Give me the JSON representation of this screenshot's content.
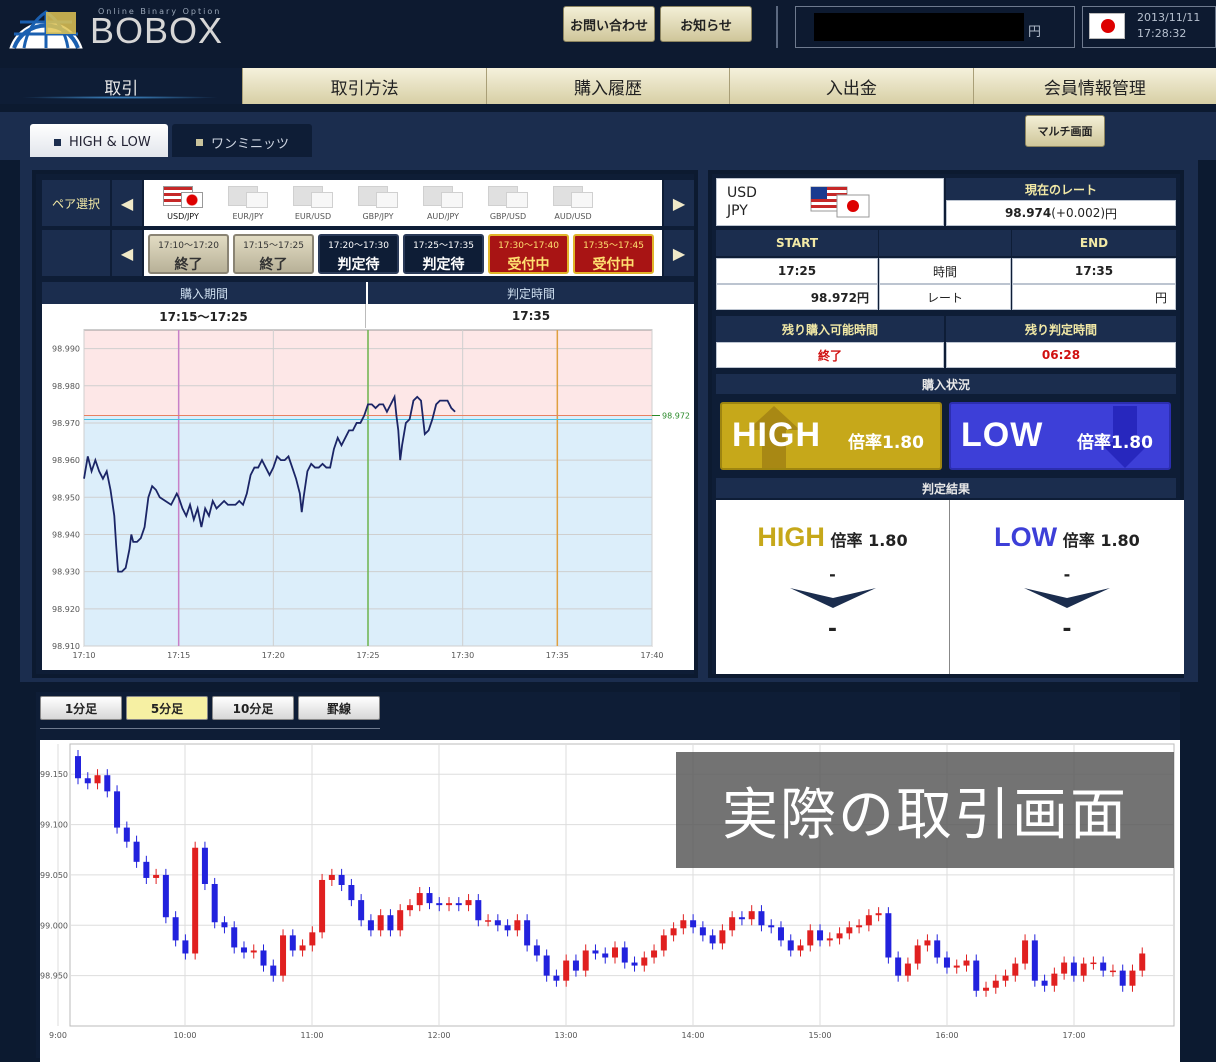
{
  "app": {
    "logo_text": "BOBOX",
    "logo_sub": "Online Binary Option"
  },
  "header": {
    "contact_label": "お問い合わせ",
    "news_label": "お知らせ",
    "balance_unit": "円",
    "date": "2013/11/11",
    "time": "17:28:32"
  },
  "nav": {
    "tabs": [
      {
        "label": "取引"
      },
      {
        "label": "取引方法"
      },
      {
        "label": "購入履歴"
      },
      {
        "label": "入出金"
      },
      {
        "label": "会員情報管理"
      }
    ]
  },
  "modes": {
    "highlow_label": "HIGH & LOW",
    "oneminute_label": "ワンミニッツ",
    "multi_label": "マルチ画面"
  },
  "pairs": {
    "label": "ペア選択",
    "prev": "◀",
    "next": "▶",
    "items": [
      {
        "label": "USD/JPY"
      },
      {
        "label": "EUR/JPY"
      },
      {
        "label": "EUR/USD"
      },
      {
        "label": "GBP/JPY"
      },
      {
        "label": "AUD/JPY"
      },
      {
        "label": "GBP/USD"
      },
      {
        "label": "AUD/USD"
      }
    ]
  },
  "slots": {
    "items": [
      {
        "range": "17:10～17:20",
        "status": "終了",
        "state": "end"
      },
      {
        "range": "17:15～17:25",
        "status": "終了",
        "state": "end"
      },
      {
        "range": "17:20～17:30",
        "status": "判定待",
        "state": "wait"
      },
      {
        "range": "17:25～17:35",
        "status": "判定待",
        "state": "wait"
      },
      {
        "range": "17:30～17:40",
        "status": "受付中",
        "state": "open"
      },
      {
        "range": "17:35～17:45",
        "status": "受付中",
        "state": "open"
      }
    ]
  },
  "trade_info": {
    "period_label": "購入期間",
    "period_value": "17:15～17:25",
    "judge_label": "判定時間",
    "judge_value": "17:35"
  },
  "chart_data": [
    {
      "type": "line",
      "ylim": [
        98.91,
        98.995
      ],
      "y_ticks": [
        "98.990",
        "98.980",
        "98.970",
        "98.960",
        "98.950",
        "98.940",
        "98.930",
        "98.920",
        "98.910"
      ],
      "x_ticks": [
        "17:10",
        "17:15",
        "17:20",
        "17:25",
        "17:30",
        "17:35",
        "17:40"
      ],
      "target_label": "98.972",
      "target": 98.972,
      "markers_time": [
        "17:15",
        "17:25",
        "17:35"
      ],
      "series": [
        {
          "values": [
            [
              0,
              98.955
            ],
            [
              0.2,
              98.961
            ],
            [
              0.4,
              98.957
            ],
            [
              0.6,
              98.96
            ],
            [
              0.8,
              98.957
            ],
            [
              1.0,
              98.955
            ],
            [
              1.2,
              98.957
            ],
            [
              1.4,
              98.952
            ],
            [
              1.6,
              98.945
            ],
            [
              1.7,
              98.937
            ],
            [
              1.8,
              98.93
            ],
            [
              2.0,
              98.93
            ],
            [
              2.2,
              98.931
            ],
            [
              2.4,
              98.936
            ],
            [
              2.5,
              98.94
            ],
            [
              2.6,
              98.938
            ],
            [
              2.8,
              98.938
            ],
            [
              3.0,
              98.939
            ],
            [
              3.2,
              98.942
            ],
            [
              3.4,
              98.95
            ],
            [
              3.6,
              98.953
            ],
            [
              3.8,
              98.952
            ],
            [
              4.0,
              98.95
            ],
            [
              4.3,
              98.949
            ],
            [
              4.6,
              98.948
            ],
            [
              4.9,
              98.951
            ],
            [
              5.0,
              98.95
            ],
            [
              5.2,
              98.947
            ],
            [
              5.4,
              98.945
            ],
            [
              5.6,
              98.948
            ],
            [
              5.8,
              98.944
            ],
            [
              6.0,
              98.947
            ],
            [
              6.2,
              98.942
            ],
            [
              6.4,
              98.947
            ],
            [
              6.6,
              98.945
            ],
            [
              6.8,
              98.949
            ],
            [
              7.0,
              98.947
            ],
            [
              7.2,
              98.948
            ],
            [
              7.4,
              98.949
            ],
            [
              7.6,
              98.948
            ],
            [
              7.8,
              98.948
            ],
            [
              8.0,
              98.948
            ],
            [
              8.2,
              98.949
            ],
            [
              8.4,
              98.948
            ],
            [
              8.6,
              98.951
            ],
            [
              8.8,
              98.956
            ],
            [
              9.0,
              98.958
            ],
            [
              9.2,
              98.958
            ],
            [
              9.4,
              98.96
            ],
            [
              9.6,
              98.958
            ],
            [
              9.8,
              98.956
            ],
            [
              10.0,
              98.958
            ],
            [
              10.2,
              98.961
            ],
            [
              10.4,
              98.96
            ],
            [
              10.6,
              98.96
            ],
            [
              10.8,
              98.961
            ],
            [
              11.0,
              98.958
            ],
            [
              11.2,
              98.955
            ],
            [
              11.4,
              98.951
            ],
            [
              11.5,
              98.946
            ],
            [
              11.6,
              98.95
            ],
            [
              11.8,
              98.957
            ],
            [
              12.0,
              98.959
            ],
            [
              12.2,
              98.958
            ],
            [
              12.4,
              98.958
            ],
            [
              12.6,
              98.959
            ],
            [
              12.8,
              98.958
            ],
            [
              13.0,
              98.958
            ],
            [
              13.2,
              98.963
            ],
            [
              13.4,
              98.966
            ],
            [
              13.6,
              98.964
            ],
            [
              13.8,
              98.966
            ],
            [
              14.0,
              98.968
            ],
            [
              14.2,
              98.968
            ],
            [
              14.4,
              98.97
            ],
            [
              14.6,
              98.97
            ],
            [
              14.8,
              98.972
            ],
            [
              15.0,
              98.975
            ],
            [
              15.2,
              98.975
            ],
            [
              15.4,
              98.974
            ],
            [
              15.6,
              98.975
            ],
            [
              15.8,
              98.975
            ],
            [
              16.0,
              98.973
            ],
            [
              16.2,
              98.975
            ],
            [
              16.4,
              98.977
            ],
            [
              16.5,
              98.972
            ],
            [
              16.6,
              98.968
            ],
            [
              16.7,
              98.96
            ],
            [
              16.8,
              98.964
            ],
            [
              17.0,
              98.97
            ],
            [
              17.2,
              98.971
            ],
            [
              17.4,
              98.976
            ],
            [
              17.6,
              98.977
            ],
            [
              17.8,
              98.976
            ],
            [
              18.0,
              98.967
            ],
            [
              18.2,
              98.968
            ],
            [
              18.4,
              98.971
            ],
            [
              18.6,
              98.975
            ],
            [
              18.8,
              98.976
            ],
            [
              19.0,
              98.976
            ],
            [
              19.2,
              98.976
            ],
            [
              19.4,
              98.974
            ],
            [
              19.6,
              98.973
            ]
          ]
        }
      ]
    },
    {
      "type": "candlestick",
      "ylim": [
        98.9,
        99.18
      ],
      "y_ticks": [
        "99.150",
        "99.100",
        "99.050",
        "99.000",
        "98.950"
      ],
      "x_ticks": [
        "9:00",
        "10:00",
        "11:00",
        "12:00",
        "13:00",
        "14:00",
        "15:00",
        "16:00",
        "17:00"
      ],
      "up_color": "#e02020",
      "down_color": "#2222dd",
      "values": [
        [
          99.168,
          99.146
        ],
        [
          99.146,
          99.141
        ],
        [
          99.141,
          99.149
        ],
        [
          99.149,
          99.133
        ],
        [
          99.133,
          99.097
        ],
        [
          99.097,
          99.083
        ],
        [
          99.083,
          99.063
        ],
        [
          99.063,
          99.047
        ],
        [
          99.047,
          99.05
        ],
        [
          99.05,
          99.008
        ],
        [
          99.008,
          98.985
        ],
        [
          98.985,
          98.972
        ],
        [
          98.972,
          99.077
        ],
        [
          99.077,
          99.041
        ],
        [
          99.041,
          99.003
        ],
        [
          99.003,
          98.998
        ],
        [
          98.998,
          98.978
        ],
        [
          98.978,
          98.973
        ],
        [
          98.973,
          98.975
        ],
        [
          98.975,
          98.96
        ],
        [
          98.96,
          98.95
        ],
        [
          98.95,
          98.99
        ],
        [
          98.99,
          98.975
        ],
        [
          98.975,
          98.98
        ],
        [
          98.98,
          98.993
        ],
        [
          98.993,
          99.045
        ],
        [
          99.045,
          99.05
        ],
        [
          99.05,
          99.04
        ],
        [
          99.04,
          99.025
        ],
        [
          99.025,
          99.005
        ],
        [
          99.005,
          98.995
        ],
        [
          98.995,
          99.01
        ],
        [
          99.01,
          98.995
        ],
        [
          98.995,
          99.015
        ],
        [
          99.015,
          99.02
        ],
        [
          99.02,
          99.032
        ],
        [
          99.032,
          99.022
        ],
        [
          99.022,
          99.02
        ],
        [
          99.02,
          99.022
        ],
        [
          99.022,
          99.02
        ],
        [
          99.02,
          99.025
        ],
        [
          99.025,
          99.005
        ],
        [
          99.005,
          99.005
        ],
        [
          99.005,
          99.0
        ],
        [
          99.0,
          98.995
        ],
        [
          98.995,
          99.005
        ],
        [
          99.005,
          98.98
        ],
        [
          98.98,
          98.97
        ],
        [
          98.97,
          98.95
        ],
        [
          98.95,
          98.945
        ],
        [
          98.945,
          98.965
        ],
        [
          98.965,
          98.955
        ],
        [
          98.955,
          98.975
        ],
        [
          98.975,
          98.972
        ],
        [
          98.972,
          98.968
        ],
        [
          98.968,
          98.978
        ],
        [
          98.978,
          98.963
        ],
        [
          98.963,
          98.96
        ],
        [
          98.96,
          98.968
        ],
        [
          98.968,
          98.975
        ],
        [
          98.975,
          98.99
        ],
        [
          98.99,
          98.997
        ],
        [
          98.997,
          99.005
        ],
        [
          99.005,
          98.998
        ],
        [
          98.998,
          98.99
        ],
        [
          98.99,
          98.982
        ],
        [
          98.982,
          98.995
        ],
        [
          98.995,
          99.008
        ],
        [
          99.008,
          99.006
        ],
        [
          99.006,
          99.014
        ],
        [
          99.014,
          99.0
        ],
        [
          99.0,
          98.998
        ],
        [
          98.998,
          98.985
        ],
        [
          98.985,
          98.975
        ],
        [
          98.975,
          98.98
        ],
        [
          98.98,
          98.995
        ],
        [
          98.995,
          98.985
        ],
        [
          98.985,
          98.987
        ],
        [
          98.987,
          98.992
        ],
        [
          98.992,
          98.998
        ],
        [
          98.998,
          99.0
        ],
        [
          99.0,
          99.01
        ],
        [
          99.01,
          99.012
        ],
        [
          99.012,
          98.968
        ],
        [
          98.968,
          98.95
        ],
        [
          98.95,
          98.962
        ],
        [
          98.962,
          98.98
        ],
        [
          98.98,
          98.985
        ],
        [
          98.985,
          98.968
        ],
        [
          98.968,
          98.958
        ],
        [
          98.958,
          98.96
        ],
        [
          98.96,
          98.965
        ],
        [
          98.965,
          98.935
        ],
        [
          98.935,
          98.938
        ],
        [
          98.938,
          98.945
        ],
        [
          98.945,
          98.95
        ],
        [
          98.95,
          98.962
        ],
        [
          98.962,
          98.985
        ],
        [
          98.985,
          98.945
        ],
        [
          98.945,
          98.94
        ],
        [
          98.94,
          98.952
        ],
        [
          98.952,
          98.963
        ],
        [
          98.963,
          98.95
        ],
        [
          98.95,
          98.962
        ],
        [
          98.962,
          98.963
        ],
        [
          98.963,
          98.955
        ],
        [
          98.955,
          98.955
        ],
        [
          98.955,
          98.94
        ],
        [
          98.94,
          98.955
        ],
        [
          98.955,
          98.972
        ]
      ]
    }
  ],
  "chart_controls": {
    "btn1": "1分足",
    "btn5": "5分足",
    "btn10": "10分足",
    "btnline": "罫線"
  },
  "watermark": "実際の取引画面",
  "rate_panel": {
    "pair_top": "USD",
    "pair_bottom": "JPY",
    "current_rate_label": "現在のレート",
    "current_rate": "98.974",
    "current_change": "(+0.002)",
    "current_unit": "円",
    "start_label": "START",
    "end_label": "END",
    "start_time": "17:25",
    "time_label": "時間",
    "end_time": "17:35",
    "start_rate": "98.972円",
    "rate_label": "レート",
    "end_rate": "円",
    "remain_buy_label": "残り購入可能時間",
    "remain_judge_label": "残り判定時間",
    "remain_buy_value": "終了",
    "remain_judge_value": "06:28",
    "purchase_status_label": "購入状況",
    "high_label": "HIGH",
    "low_label": "LOW",
    "high_mult": "倍率1.80",
    "low_mult": "倍率1.80",
    "result_label": "判定結果",
    "res_high_title": "HIGH",
    "res_low_title": "LOW",
    "res_mult_label": "倍率",
    "res_mult_value": "1.80",
    "res_dash": "-"
  }
}
